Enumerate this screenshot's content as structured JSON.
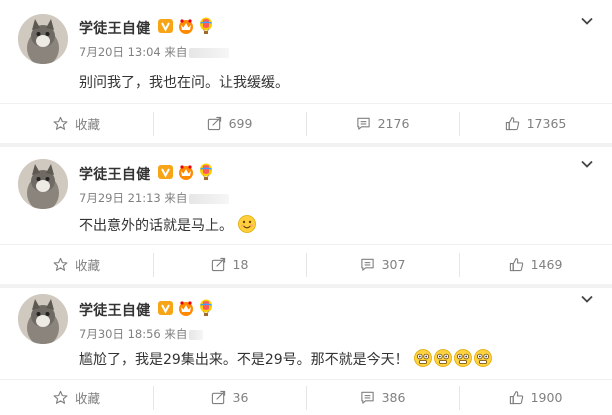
{
  "posts": [
    {
      "author": "学徒王自健",
      "meta": "7月20日 13:04 来自",
      "text": "别问我了，我也在问。让我缓缓。",
      "actions": {
        "favorite": "收藏",
        "repost": "699",
        "comment": "2176",
        "like": "17365"
      }
    },
    {
      "author": "学徒王自健",
      "meta": "7月29日 21:13 来自",
      "text": "不出意外的话就是马上。",
      "actions": {
        "favorite": "收藏",
        "repost": "18",
        "comment": "307",
        "like": "1469"
      }
    },
    {
      "author": "学徒王自健",
      "meta": "7月30日 18:56 来自",
      "text": "尴尬了，我是29集出来。不是29号。那不就是今天！",
      "actions": {
        "favorite": "收藏",
        "repost": "36",
        "comment": "386",
        "like": "1900"
      }
    }
  ],
  "icons": {
    "verified": "verified-v-badge",
    "vip": "vip-crown-badge",
    "balloon": "hot-air-balloon-badge",
    "more": "chevron-down-icon",
    "favorite": "star-icon",
    "repost": "share-arrow-icon",
    "comment": "comment-icon",
    "like": "thumbs-up-icon"
  },
  "colors": {
    "verified": "#f7a416",
    "vip": "#ff6a00",
    "muted": "#808080",
    "text": "#333333"
  }
}
